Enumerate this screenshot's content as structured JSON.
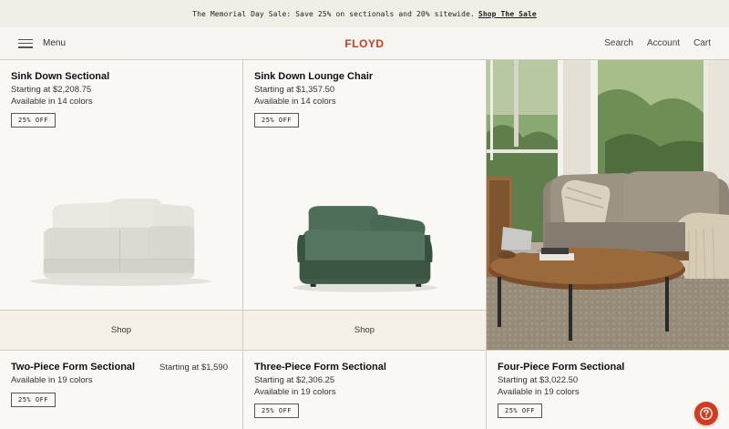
{
  "promo": {
    "text": "The Memorial Day Sale: Save 25% on sectionals and 20% sitewide.",
    "link": "Shop The Sale"
  },
  "nav": {
    "menu_label": "Menu",
    "logo": "FLOYD",
    "search": "Search",
    "account": "Account",
    "cart": "Cart"
  },
  "products": [
    {
      "name": "Sink Down Sectional",
      "price": "Starting at $2,208.75",
      "colors": "Available in 14 colors",
      "badge": "25% OFF",
      "shop": "Shop",
      "color": "#dedbd5"
    },
    {
      "name": "Sink Down Lounge Chair",
      "price": "Starting at $1,357.50",
      "colors": "Available in 14 colors",
      "badge": "25% OFF",
      "shop": "Shop",
      "color": "#4d6b57"
    },
    {
      "name": "Two-Piece Form Sectional",
      "price": "Starting at $1,590",
      "colors": "Available in 19 colors",
      "badge": "25% OFF"
    },
    {
      "name": "Three-Piece Form Sectional",
      "price": "Starting at $2,306.25",
      "colors": "Available in 19 colors",
      "badge": "25% OFF"
    },
    {
      "name": "Four-Piece Form Sectional",
      "price": "Starting at $3,022.50",
      "colors": "Available in 19 colors",
      "badge": "25% OFF"
    }
  ],
  "colors": {
    "brand": "#cf3b1d",
    "help_button": "#d33b1e"
  },
  "icons": {
    "menu": "hamburger-icon",
    "help": "question-mark-icon"
  }
}
